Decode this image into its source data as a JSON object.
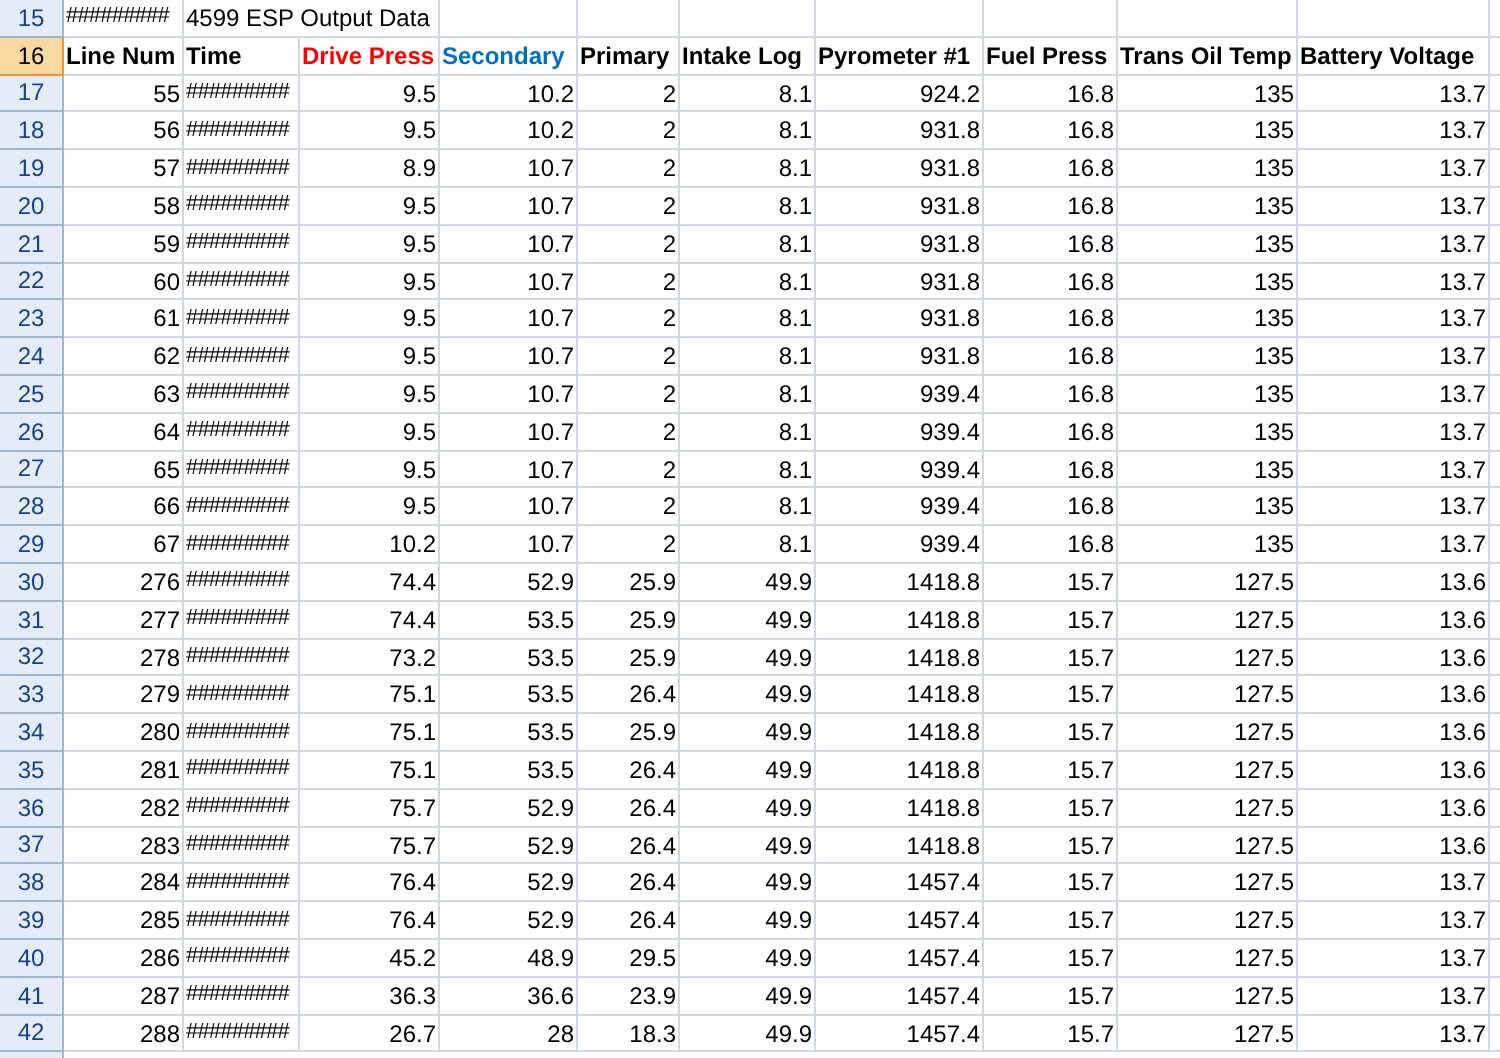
{
  "title_row": {
    "number": "15",
    "selected": false,
    "cells": [
      "#########",
      "4599 ESP Output Data"
    ]
  },
  "header_row": {
    "number": "16",
    "selected": true,
    "columns": [
      {
        "label": "Line Num",
        "color": "#000000"
      },
      {
        "label": "Time",
        "color": "#000000"
      },
      {
        "label": "Drive Press",
        "color": "#ff0000"
      },
      {
        "label": "Secondary",
        "color": "#0070c0"
      },
      {
        "label": "Primary",
        "color": "#000000"
      },
      {
        "label": "Intake Log",
        "color": "#000000"
      },
      {
        "label": "Pyrometer #1",
        "color": "#000000"
      },
      {
        "label": "Fuel Press",
        "color": "#000000"
      },
      {
        "label": "Trans Oil Temp",
        "color": "#000000"
      },
      {
        "label": "Battery Voltage",
        "color": "#000000"
      }
    ]
  },
  "rows": [
    {
      "number": "17",
      "selected": false,
      "cells": [
        "55",
        "#########",
        "9.5",
        "10.2",
        "2",
        "8.1",
        "924.2",
        "16.8",
        "135",
        "13.7"
      ]
    },
    {
      "number": "18",
      "selected": false,
      "cells": [
        "56",
        "#########",
        "9.5",
        "10.2",
        "2",
        "8.1",
        "931.8",
        "16.8",
        "135",
        "13.7"
      ]
    },
    {
      "number": "19",
      "selected": false,
      "cells": [
        "57",
        "#########",
        "8.9",
        "10.7",
        "2",
        "8.1",
        "931.8",
        "16.8",
        "135",
        "13.7"
      ]
    },
    {
      "number": "20",
      "selected": false,
      "cells": [
        "58",
        "#########",
        "9.5",
        "10.7",
        "2",
        "8.1",
        "931.8",
        "16.8",
        "135",
        "13.7"
      ]
    },
    {
      "number": "21",
      "selected": false,
      "cells": [
        "59",
        "#########",
        "9.5",
        "10.7",
        "2",
        "8.1",
        "931.8",
        "16.8",
        "135",
        "13.7"
      ]
    },
    {
      "number": "22",
      "selected": false,
      "cells": [
        "60",
        "#########",
        "9.5",
        "10.7",
        "2",
        "8.1",
        "931.8",
        "16.8",
        "135",
        "13.7"
      ]
    },
    {
      "number": "23",
      "selected": false,
      "cells": [
        "61",
        "#########",
        "9.5",
        "10.7",
        "2",
        "8.1",
        "931.8",
        "16.8",
        "135",
        "13.7"
      ]
    },
    {
      "number": "24",
      "selected": false,
      "cells": [
        "62",
        "#########",
        "9.5",
        "10.7",
        "2",
        "8.1",
        "931.8",
        "16.8",
        "135",
        "13.7"
      ]
    },
    {
      "number": "25",
      "selected": false,
      "cells": [
        "63",
        "#########",
        "9.5",
        "10.7",
        "2",
        "8.1",
        "939.4",
        "16.8",
        "135",
        "13.7"
      ]
    },
    {
      "number": "26",
      "selected": false,
      "cells": [
        "64",
        "#########",
        "9.5",
        "10.7",
        "2",
        "8.1",
        "939.4",
        "16.8",
        "135",
        "13.7"
      ]
    },
    {
      "number": "27",
      "selected": false,
      "cells": [
        "65",
        "#########",
        "9.5",
        "10.7",
        "2",
        "8.1",
        "939.4",
        "16.8",
        "135",
        "13.7"
      ]
    },
    {
      "number": "28",
      "selected": false,
      "cells": [
        "66",
        "#########",
        "9.5",
        "10.7",
        "2",
        "8.1",
        "939.4",
        "16.8",
        "135",
        "13.7"
      ]
    },
    {
      "number": "29",
      "selected": false,
      "cells": [
        "67",
        "#########",
        "10.2",
        "10.7",
        "2",
        "8.1",
        "939.4",
        "16.8",
        "135",
        "13.7"
      ]
    },
    {
      "number": "30",
      "selected": false,
      "cells": [
        "276",
        "#########",
        "74.4",
        "52.9",
        "25.9",
        "49.9",
        "1418.8",
        "15.7",
        "127.5",
        "13.6"
      ]
    },
    {
      "number": "31",
      "selected": false,
      "cells": [
        "277",
        "#########",
        "74.4",
        "53.5",
        "25.9",
        "49.9",
        "1418.8",
        "15.7",
        "127.5",
        "13.6"
      ]
    },
    {
      "number": "32",
      "selected": false,
      "cells": [
        "278",
        "#########",
        "73.2",
        "53.5",
        "25.9",
        "49.9",
        "1418.8",
        "15.7",
        "127.5",
        "13.6"
      ]
    },
    {
      "number": "33",
      "selected": false,
      "cells": [
        "279",
        "#########",
        "75.1",
        "53.5",
        "26.4",
        "49.9",
        "1418.8",
        "15.7",
        "127.5",
        "13.6"
      ]
    },
    {
      "number": "34",
      "selected": false,
      "cells": [
        "280",
        "#########",
        "75.1",
        "53.5",
        "25.9",
        "49.9",
        "1418.8",
        "15.7",
        "127.5",
        "13.6"
      ]
    },
    {
      "number": "35",
      "selected": false,
      "cells": [
        "281",
        "#########",
        "75.1",
        "53.5",
        "26.4",
        "49.9",
        "1418.8",
        "15.7",
        "127.5",
        "13.6"
      ]
    },
    {
      "number": "36",
      "selected": false,
      "cells": [
        "282",
        "#########",
        "75.7",
        "52.9",
        "26.4",
        "49.9",
        "1418.8",
        "15.7",
        "127.5",
        "13.6"
      ]
    },
    {
      "number": "37",
      "selected": false,
      "cells": [
        "283",
        "#########",
        "75.7",
        "52.9",
        "26.4",
        "49.9",
        "1418.8",
        "15.7",
        "127.5",
        "13.6"
      ]
    },
    {
      "number": "38",
      "selected": false,
      "cells": [
        "284",
        "#########",
        "76.4",
        "52.9",
        "26.4",
        "49.9",
        "1457.4",
        "15.7",
        "127.5",
        "13.7"
      ]
    },
    {
      "number": "39",
      "selected": false,
      "cells": [
        "285",
        "#########",
        "76.4",
        "52.9",
        "26.4",
        "49.9",
        "1457.4",
        "15.7",
        "127.5",
        "13.7"
      ]
    },
    {
      "number": "40",
      "selected": false,
      "cells": [
        "286",
        "#########",
        "45.2",
        "48.9",
        "29.5",
        "49.9",
        "1457.4",
        "15.7",
        "127.5",
        "13.7"
      ]
    },
    {
      "number": "41",
      "selected": false,
      "cells": [
        "287",
        "#########",
        "36.3",
        "36.6",
        "23.9",
        "49.9",
        "1457.4",
        "15.7",
        "127.5",
        "13.7"
      ]
    },
    {
      "number": "42",
      "selected": false,
      "cells": [
        "288",
        "#########",
        "26.7",
        "28",
        "18.3",
        "49.9",
        "1457.4",
        "15.7",
        "127.5",
        "13.7"
      ]
    }
  ]
}
